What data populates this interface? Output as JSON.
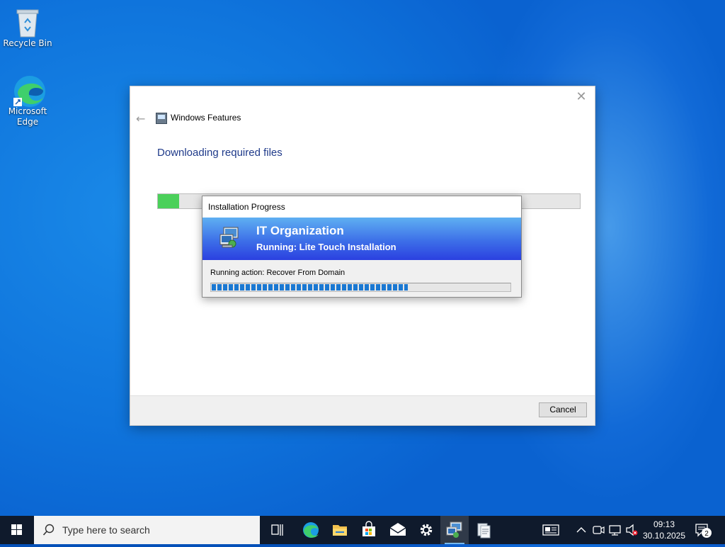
{
  "desktop": {
    "icons": [
      {
        "label": "Recycle Bin"
      },
      {
        "label_line1": "Microsoft",
        "label_line2": "Edge"
      }
    ]
  },
  "windows_features": {
    "title": "Windows Features",
    "heading": "Downloading required files",
    "progress_fraction": 0.05,
    "cancel_label": "Cancel",
    "close_glyph": "✕",
    "back_glyph": "←"
  },
  "installation_progress": {
    "title": "Installation Progress",
    "organization": "IT Organization",
    "running": "Running: Lite Touch Installation",
    "action": "Running action: Recover From Domain",
    "progress_fraction": 0.66
  },
  "taskbar": {
    "search_placeholder": "Type here to search",
    "time": "09:13",
    "date": "30.10.2025",
    "notification_count": "2",
    "pinned": [
      "task-view-icon",
      "edge-icon",
      "file-explorer-icon",
      "store-icon",
      "mail-icon",
      "settings-icon",
      "deployment-icon",
      "notepad-icon"
    ]
  },
  "colors": {
    "accent_progress": "#1a78d2",
    "green_progress": "#4bd05a",
    "banner_top": "#5fb0f2",
    "banner_bottom": "#2b40e0",
    "heading_text": "#1f3a8a"
  }
}
